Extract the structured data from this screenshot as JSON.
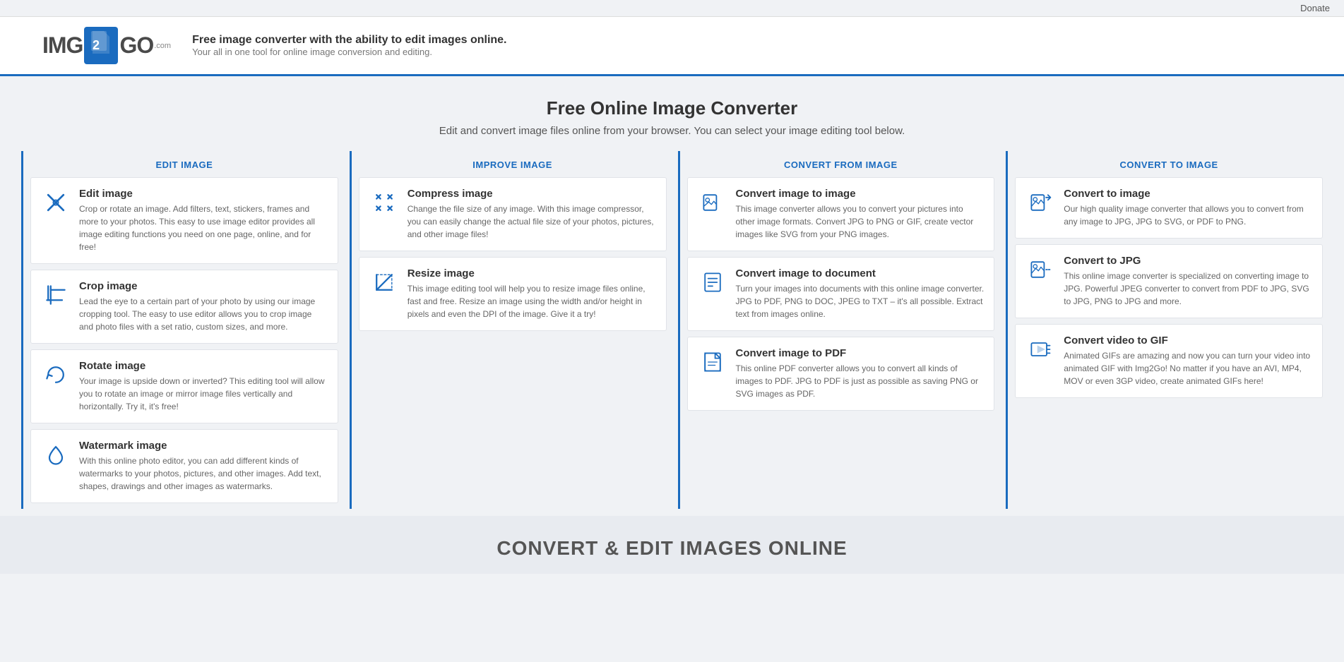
{
  "topbar": {
    "donate_label": "Donate"
  },
  "header": {
    "logo_img": "IMG",
    "logo_num": "2",
    "logo_go": "GO",
    "logo_com": ".com",
    "tagline_main": "Free image converter with the ability to edit images online.",
    "tagline_sub": "Your all in one tool for online image conversion and editing."
  },
  "hero": {
    "title": "Free Online Image Converter",
    "subtitle": "Edit and convert image files online from your browser. You can select your image editing tool below."
  },
  "categories": [
    {
      "id": "edit-image",
      "header": "EDIT IMAGE",
      "tools": [
        {
          "id": "edit-image-tool",
          "title": "Edit image",
          "desc": "Crop or rotate an image. Add filters, text, stickers, frames and more to your photos. This easy to use image editor provides all image editing functions you need on one page, online, and for free!",
          "icon": "edit"
        },
        {
          "id": "crop-image",
          "title": "Crop image",
          "desc": "Lead the eye to a certain part of your photo by using our image cropping tool. The easy to use editor allows you to crop image and photo files with a set ratio, custom sizes, and more.",
          "icon": "crop"
        },
        {
          "id": "rotate-image",
          "title": "Rotate image",
          "desc": "Your image is upside down or inverted? This editing tool will allow you to rotate an image or mirror image files vertically and horizontally. Try it, it's free!",
          "icon": "rotate"
        },
        {
          "id": "watermark-image",
          "title": "Watermark image",
          "desc": "With this online photo editor, you can add different kinds of watermarks to your photos, pictures, and other images. Add text, shapes, drawings and other images as watermarks.",
          "icon": "watermark"
        }
      ]
    },
    {
      "id": "improve-image",
      "header": "IMPROVE IMAGE",
      "tools": [
        {
          "id": "compress-image",
          "title": "Compress image",
          "desc": "Change the file size of any image. With this image compressor, you can easily change the actual file size of your photos, pictures, and other image files!",
          "icon": "compress"
        },
        {
          "id": "resize-image",
          "title": "Resize image",
          "desc": "This image editing tool will help you to resize image files online, fast and free. Resize an image using the width and/or height in pixels and even the DPI of the image. Give it a try!",
          "icon": "resize"
        }
      ]
    },
    {
      "id": "convert-from-image",
      "header": "CONVERT FROM IMAGE",
      "tools": [
        {
          "id": "convert-image-to-image",
          "title": "Convert image to image",
          "desc": "This image converter allows you to convert your pictures into other image formats. Convert JPG to PNG or GIF, create vector images like SVG from your PNG images.",
          "icon": "convert-image"
        },
        {
          "id": "convert-image-to-document",
          "title": "Convert image to document",
          "desc": "Turn your images into documents with this online image converter. JPG to PDF, PNG to DOC, JPEG to TXT – it's all possible. Extract text from images online.",
          "icon": "convert-doc"
        },
        {
          "id": "convert-image-to-pdf",
          "title": "Convert image to PDF",
          "desc": "This online PDF converter allows you to convert all kinds of images to PDF. JPG to PDF is just as possible as saving PNG or SVG images as PDF.",
          "icon": "convert-pdf"
        }
      ]
    },
    {
      "id": "convert-to-image",
      "header": "CONVERT TO IMAGE",
      "tools": [
        {
          "id": "convert-to-image-tool",
          "title": "Convert to image",
          "desc": "Our high quality image converter that allows you to convert from any image to JPG, JPG to SVG, or PDF to PNG.",
          "icon": "to-image"
        },
        {
          "id": "convert-to-jpg",
          "title": "Convert to JPG",
          "desc": "This online image converter is specialized on converting image to JPG. Powerful JPEG converter to convert from PDF to JPG, SVG to JPG, PNG to JPG and more.",
          "icon": "to-jpg"
        },
        {
          "id": "convert-video-to-gif",
          "title": "Convert video to GIF",
          "desc": "Animated GIFs are amazing and now you can turn your video into animated GIF with Img2Go! No matter if you have an AVI, MP4, MOV or even 3GP video, create animated GIFs here!",
          "icon": "to-gif"
        }
      ]
    }
  ],
  "footer_banner": {
    "title": "CONVERT & EDIT IMAGES ONLINE"
  }
}
